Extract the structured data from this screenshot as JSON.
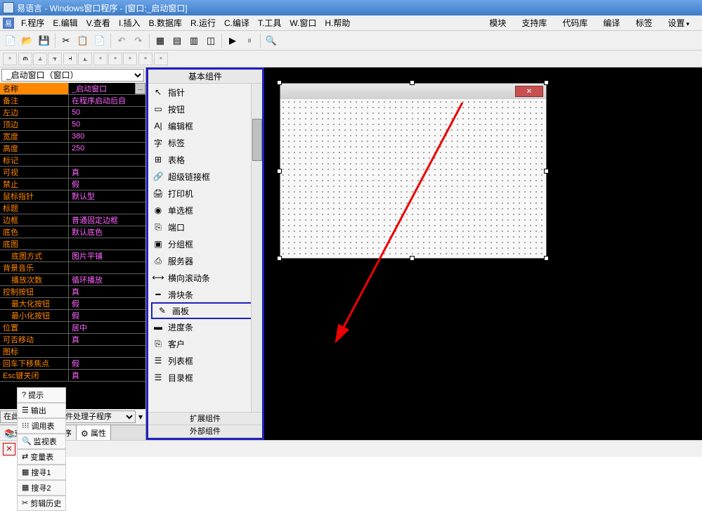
{
  "titlebar": {
    "text": "易语言 - Windows窗口程序 - [窗口:_启动窗口]"
  },
  "menubar": {
    "items": [
      "F.程序",
      "E.编辑",
      "V.查看",
      "I.插入",
      "B.数据库",
      "R.运行",
      "C.编译",
      "T.工具",
      "W.窗口",
      "H.帮助"
    ],
    "right": [
      "模块",
      "支持库",
      "代码库",
      "编译",
      "标签",
      "设置"
    ]
  },
  "propPanel": {
    "selector": "_启动窗口（窗口）",
    "rows": [
      {
        "key": "名称",
        "val": "_启动窗口",
        "header": true,
        "extra": "..."
      },
      {
        "key": "备注",
        "val": "在程序启动后自"
      },
      {
        "key": "左边",
        "val": "50"
      },
      {
        "key": "顶边",
        "val": "50"
      },
      {
        "key": "宽度",
        "val": "380"
      },
      {
        "key": "高度",
        "val": "250"
      },
      {
        "key": "标记",
        "val": ""
      },
      {
        "key": "可视",
        "val": "真"
      },
      {
        "key": "禁止",
        "val": "假"
      },
      {
        "key": "鼠标指针",
        "val": "默认型"
      },
      {
        "key": "标题",
        "val": ""
      },
      {
        "key": "边框",
        "val": "普通固定边框"
      },
      {
        "key": "底色",
        "val": "默认底色"
      },
      {
        "key": "底图",
        "val": ""
      },
      {
        "key": "底图方式",
        "val": "图片平铺",
        "indent": true
      },
      {
        "key": "背景音乐",
        "val": ""
      },
      {
        "key": "播放次数",
        "val": "循环播放",
        "indent": true
      },
      {
        "key": "控制按钮",
        "val": "真"
      },
      {
        "key": "最大化按钮",
        "val": "假",
        "indent": true
      },
      {
        "key": "最小化按钮",
        "val": "假",
        "indent": true
      },
      {
        "key": "位置",
        "val": "居中"
      },
      {
        "key": "可否移动",
        "val": "真"
      },
      {
        "key": "图标",
        "val": ""
      },
      {
        "key": "回车下移焦点",
        "val": "假"
      },
      {
        "key": "Esc键关闭",
        "val": "真"
      }
    ],
    "eventPlaceholder": "在此处选择加入事件处理子程序",
    "tabs": [
      "支持库",
      "程序",
      "属性"
    ]
  },
  "componentPanel": {
    "header": "基本组件",
    "items": [
      {
        "icon": "↖",
        "label": "指针"
      },
      {
        "icon": "▭",
        "label": "按钮"
      },
      {
        "icon": "A|",
        "label": "编辑框"
      },
      {
        "icon": "字",
        "label": "标签"
      },
      {
        "icon": "⊞",
        "label": "表格"
      },
      {
        "icon": "🔗",
        "label": "超级链接框"
      },
      {
        "icon": "🖨",
        "label": "打印机"
      },
      {
        "icon": "◉",
        "label": "单选框"
      },
      {
        "icon": "⎘",
        "label": "端口"
      },
      {
        "icon": "▣",
        "label": "分组框"
      },
      {
        "icon": "⎙",
        "label": "服务器"
      },
      {
        "icon": "⟷",
        "label": "横向滚动条"
      },
      {
        "icon": "━",
        "label": "滑块条"
      },
      {
        "icon": "✎",
        "label": "画板",
        "highlighted": true
      },
      {
        "icon": "▬",
        "label": "进度条"
      },
      {
        "icon": "⎘",
        "label": "客户"
      },
      {
        "icon": "☰",
        "label": "列表框"
      },
      {
        "icon": "☰",
        "label": "目录框"
      }
    ],
    "footer": [
      "扩展组件",
      "外部组件"
    ]
  },
  "bottomTabs": {
    "items": [
      {
        "icon": "?",
        "label": "提示"
      },
      {
        "icon": "☰",
        "label": "输出"
      },
      {
        "icon": "⁝⁝⁝",
        "label": "调用表"
      },
      {
        "icon": "🔍",
        "label": "监视表"
      },
      {
        "icon": "⇄",
        "label": "变量表"
      },
      {
        "icon": "▦",
        "label": "搜寻1"
      },
      {
        "icon": "▦",
        "label": "搜寻2"
      },
      {
        "icon": "✂",
        "label": "剪辑历史"
      }
    ]
  }
}
